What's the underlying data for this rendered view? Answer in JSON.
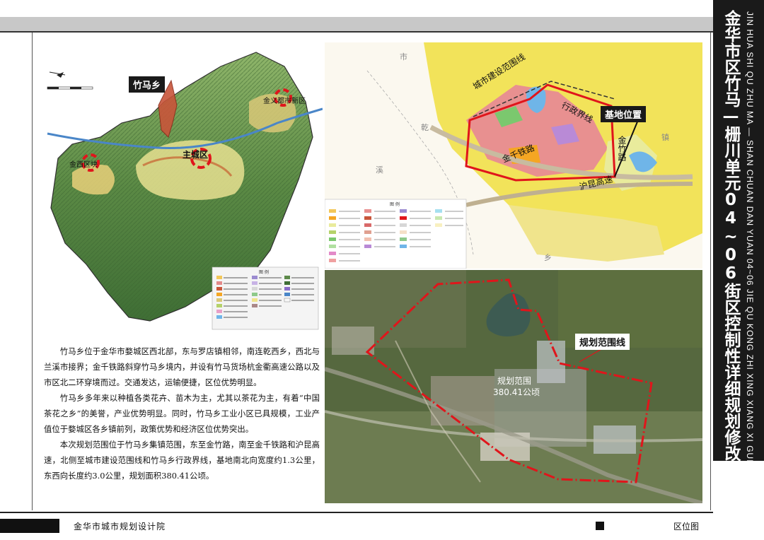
{
  "title": {
    "chinese": "金华市区竹马—栅川单元04~06街区控制性详细规划修改",
    "pinyin": "JIN HUA SHI QU ZHU MA — SHAN CHUAN DAN YUAN 04~06 JIE QU KONG ZHI XING XIANG XI GUI HUA XIU GAI"
  },
  "left_map": {
    "labels": {
      "zhuma": "竹马乡",
      "jinyi": "金义都市新区",
      "main_city": "主城区",
      "jinxi": "金西区块"
    },
    "legend_title": "图 例"
  },
  "right_map": {
    "labels": {
      "city_boundary": "城市建设范围线",
      "admin_boundary": "行政界线",
      "base_location": "基地位置",
      "jinzhu_road": "金竹路",
      "jinqian_railway": "金千铁路",
      "hukun_expressway": "沪昆高速",
      "shi": "市",
      "qian": "乾",
      "xi": "溪",
      "xiang": "乡",
      "zhen": "镇"
    },
    "legend_title": "图 例"
  },
  "satellite": {
    "labels": {
      "boundary": "规划范围线",
      "area_title": "规划范围",
      "area_value": "380.41公顷"
    }
  },
  "description": [
    "竹马乡位于金华市婺城区西北部，东与罗店镇相邻，南连乾西乡，西北与兰溪市接界；金千铁路斜穿竹马乡境内，并设有竹马货场杭金衢高速公路以及市区北二环穿境而过。交通发达，运输便捷，区位优势明显。",
    "竹马乡多年来以种植各类花卉、苗木为主，尤其以茶花为主，有着“中国茶花之乡”的美誉，产业优势明显。同时，竹马乡工业小区已具规模，工业产值位于婺城区各乡镇前列，政策优势和经济区位优势突出。",
    "本次规划范围位于竹马乡集镇范围，东至金竹路，南至金千铁路和沪昆高速，北侧至城市建设范围线和竹马乡行政界线，基地南北向宽度约1.3公里，东西向长度约3.0公里，规划面积380.41公顷。"
  ],
  "footer": {
    "institute": "金华市城市规划设计院",
    "drawing_name": "区位图"
  },
  "colors": {
    "boundary_red": "#e0151b",
    "title_bar": "#1a1a1a",
    "terrain_green": "#5d8a4a",
    "urban_yellow": "#f2e35a"
  }
}
